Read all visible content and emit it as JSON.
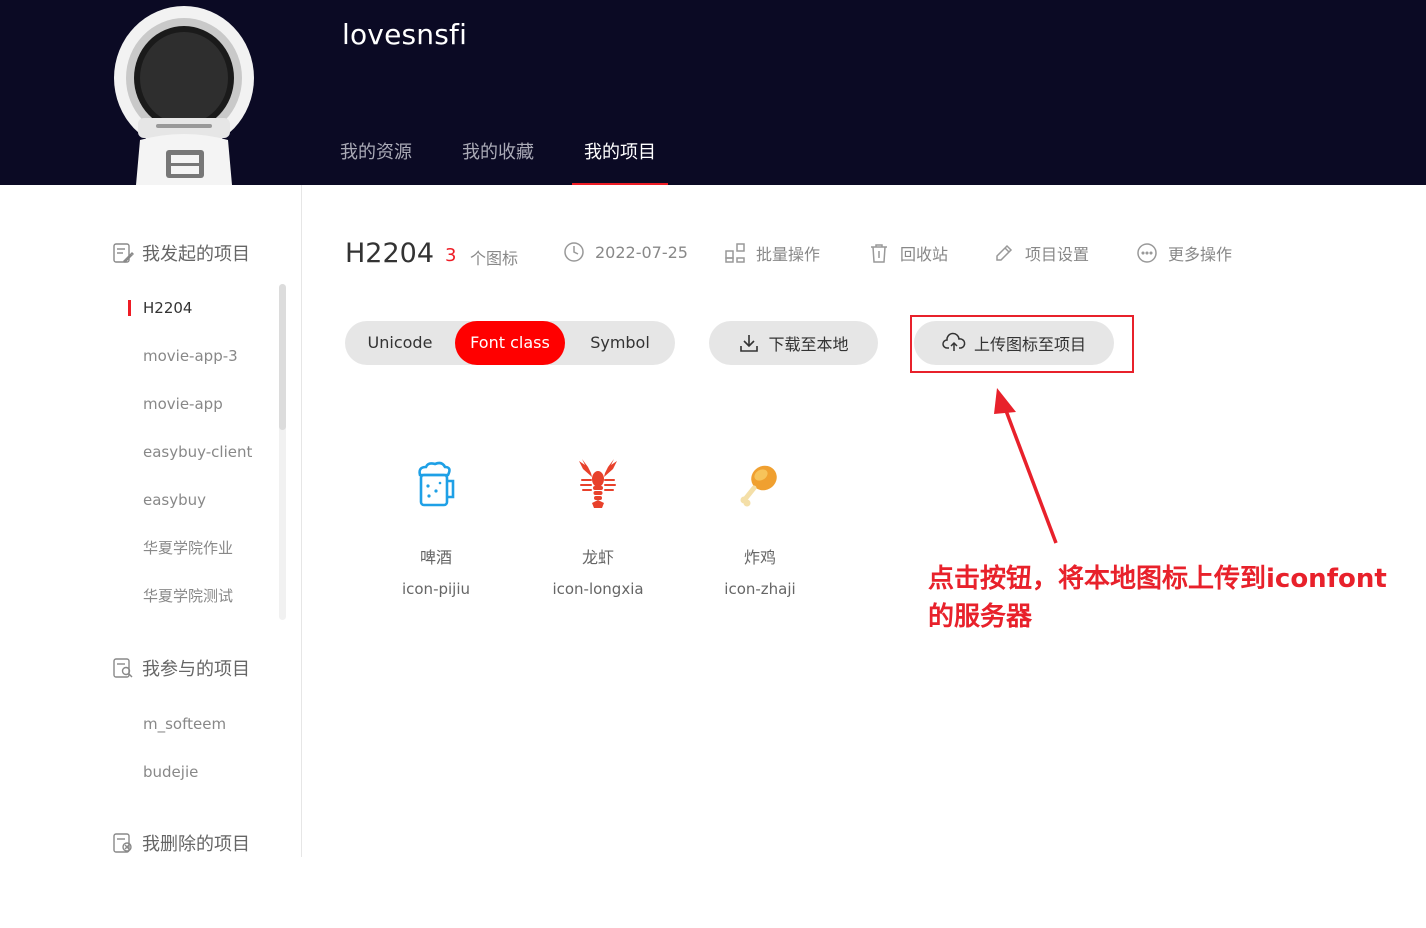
{
  "header": {
    "username": "lovesnsfi",
    "nav": [
      {
        "label": "我的资源"
      },
      {
        "label": "我的收藏"
      },
      {
        "label": "我的项目"
      }
    ]
  },
  "sidebar": {
    "created_title": "我发起的项目",
    "created_projects": [
      {
        "label": "H2204"
      },
      {
        "label": "movie-app-3"
      },
      {
        "label": "movie-app"
      },
      {
        "label": "easybuy-client"
      },
      {
        "label": "easybuy"
      },
      {
        "label": "华夏学院作业"
      },
      {
        "label": "华夏学院测试"
      }
    ],
    "joined_title": "我参与的项目",
    "joined_projects": [
      {
        "label": "m_softeem"
      },
      {
        "label": "budejie"
      }
    ],
    "deleted_title": "我删除的项目"
  },
  "project": {
    "name": "H2204",
    "icon_count": "3",
    "icon_count_label": "个图标",
    "date": "2022-07-25",
    "actions": {
      "batch": "批量操作",
      "recycle": "回收站",
      "settings": "项目设置",
      "more": "更多操作"
    }
  },
  "toolbar": {
    "unicode": "Unicode",
    "font_class": "Font class",
    "symbol": "Symbol",
    "download": "下载至本地",
    "upload": "上传图标至项目"
  },
  "icons": [
    {
      "name": "啤酒",
      "code": "icon-pijiu",
      "color": "#1ea0e6",
      "icon": "beer-icon"
    },
    {
      "name": "龙虾",
      "code": "icon-longxia",
      "color": "#e8412b",
      "icon": "lobster-icon"
    },
    {
      "name": "炸鸡",
      "code": "icon-zhaji",
      "color": "#f0a030",
      "icon": "fried-chicken-icon"
    }
  ],
  "annotation": {
    "line1": "点击按钮，将本地图标上传到iconfont",
    "line2": "的服务器"
  },
  "colors": {
    "header_bg": "#0b0a24",
    "accent": "#ee1c25",
    "annotation": "#e8212b"
  }
}
